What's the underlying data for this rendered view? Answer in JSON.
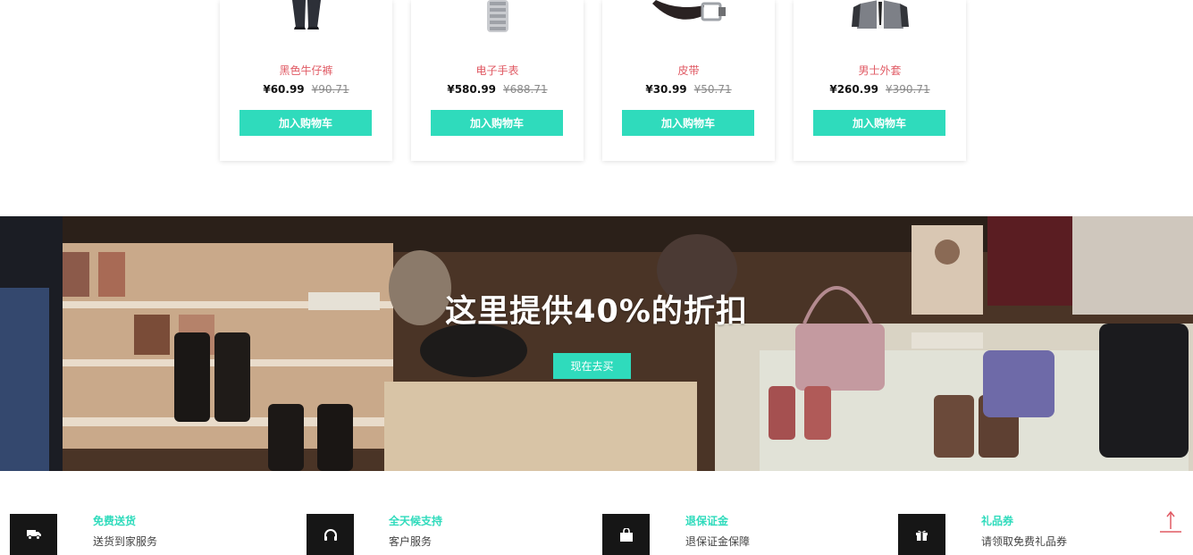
{
  "products": [
    {
      "name": "黑色牛仔裤",
      "price": "¥60.99",
      "old_price": "¥90.71",
      "button": "加入购物车",
      "image_icon": "jeans-image"
    },
    {
      "name": "电子手表",
      "price": "¥580.99",
      "old_price": "¥688.71",
      "button": "加入购物车",
      "image_icon": "watch-image"
    },
    {
      "name": "皮带",
      "price": "¥30.99",
      "old_price": "¥50.71",
      "button": "加入购物车",
      "image_icon": "belt-image"
    },
    {
      "name": "男士外套",
      "price": "¥260.99",
      "old_price": "¥390.71",
      "button": "加入购物车",
      "image_icon": "jacket-image"
    }
  ],
  "banner": {
    "headline": "这里提供40%的折扣",
    "button": "现在去买"
  },
  "features": [
    {
      "title": "免费送货",
      "desc": "送货到家服务",
      "icon": "truck-icon"
    },
    {
      "title": "全天候支持",
      "desc": "客户服务",
      "icon": "headphones-icon"
    },
    {
      "title": "退保证金",
      "desc": "退保证金保障",
      "icon": "shopping-bag-icon"
    },
    {
      "title": "礼品券",
      "desc": "请领取免费礼品券",
      "icon": "gift-icon"
    }
  ],
  "colors": {
    "accent": "#2fdbbc",
    "product_name": "#e05a64",
    "icon_box": "#161616",
    "back_to_top": "#e05a64"
  },
  "back_to_top_icon": "arrow-up-icon"
}
